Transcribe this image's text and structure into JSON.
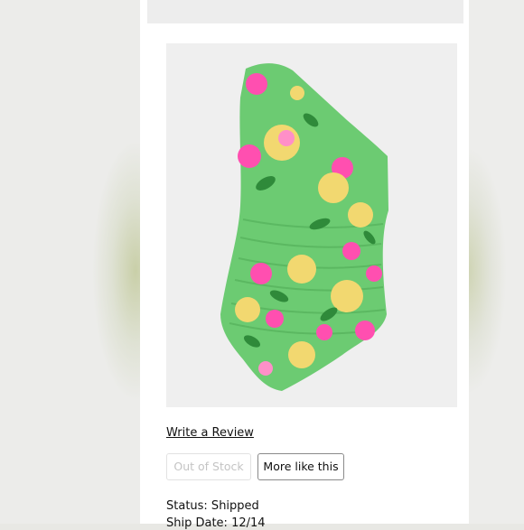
{
  "listing": {
    "image_alt": "Green floral one-shoulder ruched swimsuit",
    "review_link": "Write a Review",
    "buttons": {
      "out_of_stock": "Out of Stock",
      "more_like_this": "More like this"
    },
    "status": "Status: Shipped",
    "ship_date": "Ship Date: 12/14"
  },
  "colors": {
    "swimsuit_green": "#6ccb72",
    "flower_pink": "#ff4fb0",
    "flower_yellow": "#f2d870",
    "leaf_dark": "#2f8a3a"
  }
}
